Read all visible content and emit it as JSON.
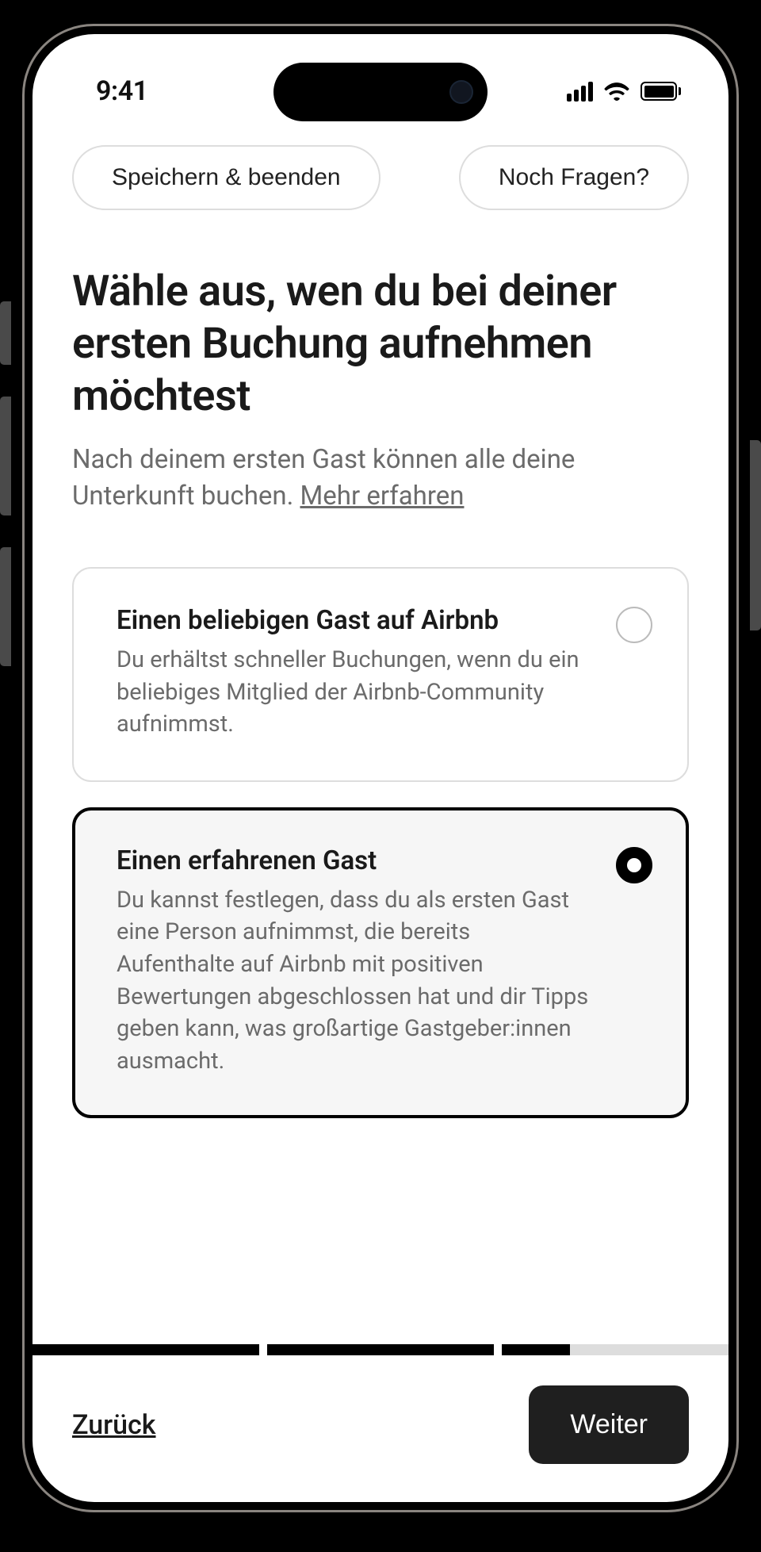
{
  "status": {
    "time": "9:41"
  },
  "header": {
    "save_exit": "Speichern & beenden",
    "questions": "Noch Fragen?"
  },
  "page": {
    "title": "Wähle aus, wen du bei deiner ersten Buchung aufnehmen möchtest",
    "subtitle_before": "Nach deinem ersten Gast können alle deine Unterkunft buchen. ",
    "learn_more": "Mehr erfahren"
  },
  "options": [
    {
      "title": "Einen beliebigen Gast auf Airbnb",
      "description": "Du erhältst schneller Buchungen, wenn du ein beliebiges Mitglied der Airbnb-Community aufnimmst.",
      "selected": false
    },
    {
      "title": "Einen erfahrenen Gast",
      "description": "Du kannst festlegen, dass du als ersten Gast eine Person aufnimmst, die bereits Aufenthalte auf Airbnb mit positiven Bewertungen abgeschlossen hat und dir Tipps geben kann, was großartige Gastgeber:innen ausmacht.",
      "selected": true
    }
  ],
  "progress": {
    "segments": [
      {
        "fill_percent": 100
      },
      {
        "fill_percent": 100
      },
      {
        "fill_percent": 30
      }
    ]
  },
  "footer": {
    "back": "Zurück",
    "next": "Weiter"
  }
}
